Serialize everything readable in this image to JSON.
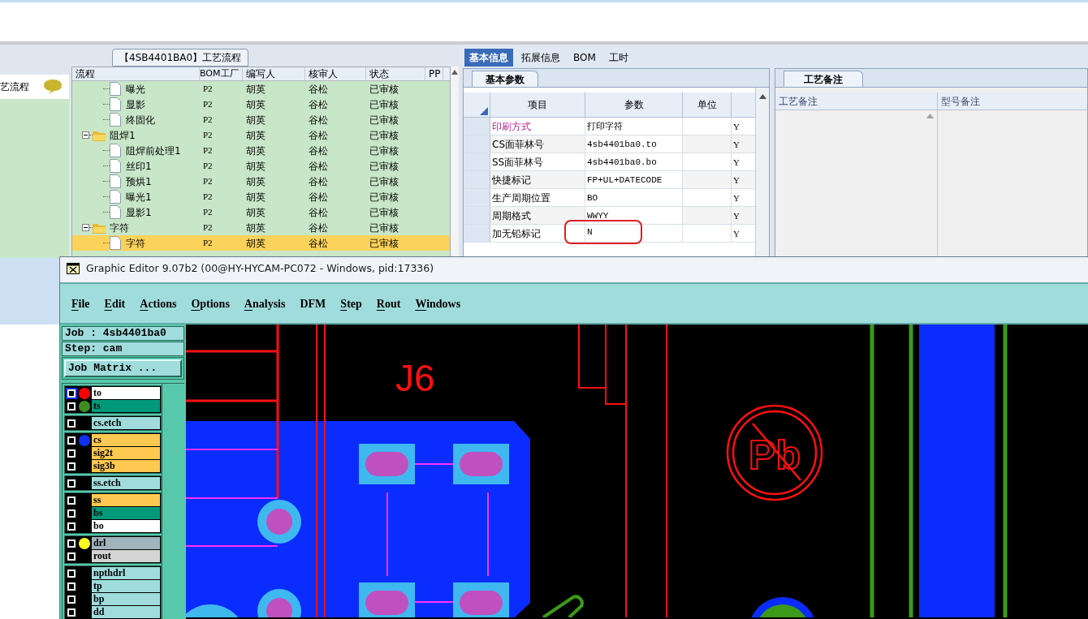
{
  "process_panel": {
    "caption": "【4SB4401BA0】工艺流程",
    "side_label": "艺流程",
    "columns": [
      "流程",
      "BOM工厂",
      "编写人",
      "核审人",
      "状态",
      "PP"
    ],
    "tree": [
      {
        "kind": "continued",
        "children": [
          {
            "label": "曝光",
            "bom": "P2",
            "writer": "胡英",
            "reviewer": "谷松",
            "status": "已审核",
            "selected": false
          },
          {
            "label": "显影",
            "bom": "P2",
            "writer": "胡英",
            "reviewer": "谷松",
            "status": "已审核",
            "selected": false
          },
          {
            "label": "终固化",
            "bom": "P2",
            "writer": "胡英",
            "reviewer": "谷松",
            "status": "已审核",
            "selected": false
          }
        ]
      },
      {
        "kind": "folder",
        "label": "阻焊1",
        "bom": "P2",
        "writer": "胡英",
        "reviewer": "谷松",
        "status": "已审核",
        "selected": false,
        "expanded": true,
        "children": [
          {
            "label": "阻焊前处理1",
            "bom": "P2",
            "writer": "胡英",
            "reviewer": "谷松",
            "status": "已审核",
            "selected": false
          },
          {
            "label": "丝印1",
            "bom": "P2",
            "writer": "胡英",
            "reviewer": "谷松",
            "status": "已审核",
            "selected": false
          },
          {
            "label": "预烘1",
            "bom": "P2",
            "writer": "胡英",
            "reviewer": "谷松",
            "status": "已审核",
            "selected": false
          },
          {
            "label": "曝光1",
            "bom": "P2",
            "writer": "胡英",
            "reviewer": "谷松",
            "status": "已审核",
            "selected": false
          },
          {
            "label": "显影1",
            "bom": "P2",
            "writer": "胡英",
            "reviewer": "谷松",
            "status": "已审核",
            "selected": false
          }
        ]
      },
      {
        "kind": "folder",
        "label": "字符",
        "bom": "P2",
        "writer": "胡英",
        "reviewer": "谷松",
        "status": "已审核",
        "selected": false,
        "expanded": true,
        "children": [
          {
            "label": "字符",
            "bom": "P2",
            "writer": "胡英",
            "reviewer": "谷松",
            "status": "已审核",
            "selected": true
          }
        ]
      }
    ]
  },
  "info_panel": {
    "tabs": [
      {
        "label": "基本信息",
        "selected": true
      },
      {
        "label": "拓展信息",
        "selected": false
      },
      {
        "label": "BOM",
        "selected": false
      },
      {
        "label": "工时",
        "selected": false
      }
    ],
    "params": {
      "tab": "基本参数",
      "columns": [
        "项目",
        "参数",
        "单位"
      ],
      "rows": [
        {
          "item": "印刷方式",
          "value": "打印字符",
          "flag": "Y",
          "highlighted": true,
          "circled": false
        },
        {
          "item": "CS面菲林号",
          "value": "4sb4401ba0.to",
          "flag": "Y",
          "highlighted": false,
          "circled": false
        },
        {
          "item": "SS面菲林号",
          "value": "4sb4401ba0.bo",
          "flag": "Y",
          "highlighted": false,
          "circled": false
        },
        {
          "item": "快捷标记",
          "value": "FP+UL+DATECODE",
          "flag": "Y",
          "highlighted": false,
          "circled": false
        },
        {
          "item": "生产周期位置",
          "value": "BO",
          "flag": "Y",
          "highlighted": false,
          "circled": false
        },
        {
          "item": "周期格式",
          "value": "WWYY",
          "flag": "Y",
          "highlighted": false,
          "circled": false
        },
        {
          "item": "加无铅标记",
          "value": "N",
          "flag": "Y",
          "highlighted": false,
          "circled": true
        }
      ]
    },
    "notes": {
      "tab": "工艺备注",
      "columns": [
        "工艺备注",
        "型号备注"
      ]
    }
  },
  "editor": {
    "title": "Graphic Editor 9.07b2 (00@HY-HYCAM-PC072 - Windows, pid:17336)",
    "menu": [
      {
        "label": "File",
        "underline_first": true
      },
      {
        "label": "Edit",
        "underline_first": true
      },
      {
        "label": "Actions",
        "underline_first": true
      },
      {
        "label": "Options",
        "underline_first": true
      },
      {
        "label": "Analysis",
        "underline_first": true
      },
      {
        "label": "DFM",
        "underline_first": false
      },
      {
        "label": "Step",
        "underline_first": true
      },
      {
        "label": "Rout",
        "underline_first": true
      },
      {
        "label": "Windows",
        "underline_first": true
      }
    ],
    "job": "Job : 4sb4401ba0",
    "step": "Step: cam",
    "matrix_button": "Job Matrix ...",
    "layer_groups": [
      [
        {
          "name": "to",
          "kind": "silk",
          "color": "#ff0000",
          "checked": false,
          "focused": true
        },
        {
          "name": "ts",
          "kind": "mask",
          "color": "#3c8c1e",
          "checked": false,
          "focused": false
        }
      ],
      [
        {
          "name": "cs.etch",
          "kind": "document",
          "checked": false,
          "focused": false
        }
      ],
      [
        {
          "name": "cs",
          "kind": "signal",
          "color": "#1030f0",
          "checked": false,
          "focused": false
        },
        {
          "name": "sig2t",
          "kind": "signal",
          "checked": false,
          "focused": false
        },
        {
          "name": "sig3b",
          "kind": "signal",
          "checked": false,
          "focused": false
        }
      ],
      [
        {
          "name": "ss.etch",
          "kind": "document",
          "checked": false,
          "focused": false
        }
      ],
      [
        {
          "name": "ss",
          "kind": "signal",
          "checked": false,
          "focused": false
        },
        {
          "name": "bs",
          "kind": "mask",
          "checked": false,
          "focused": false
        },
        {
          "name": "bo",
          "kind": "silk",
          "checked": false,
          "focused": false
        }
      ],
      [
        {
          "name": "drl",
          "kind": "drill",
          "color": "#ffff20",
          "checked": false,
          "focused": false
        },
        {
          "name": "rout",
          "kind": "rout",
          "checked": false,
          "focused": false
        }
      ],
      [
        {
          "name": "npthdrl",
          "kind": "document",
          "checked": false,
          "focused": false
        },
        {
          "name": "tp",
          "kind": "document",
          "checked": false,
          "focused": false
        },
        {
          "name": "bp",
          "kind": "document",
          "checked": false,
          "focused": false
        },
        {
          "name": "dd",
          "kind": "document",
          "checked": false,
          "focused": false
        }
      ]
    ],
    "canvas": {
      "designator": "J6",
      "lead_free_text": "Pb"
    }
  }
}
